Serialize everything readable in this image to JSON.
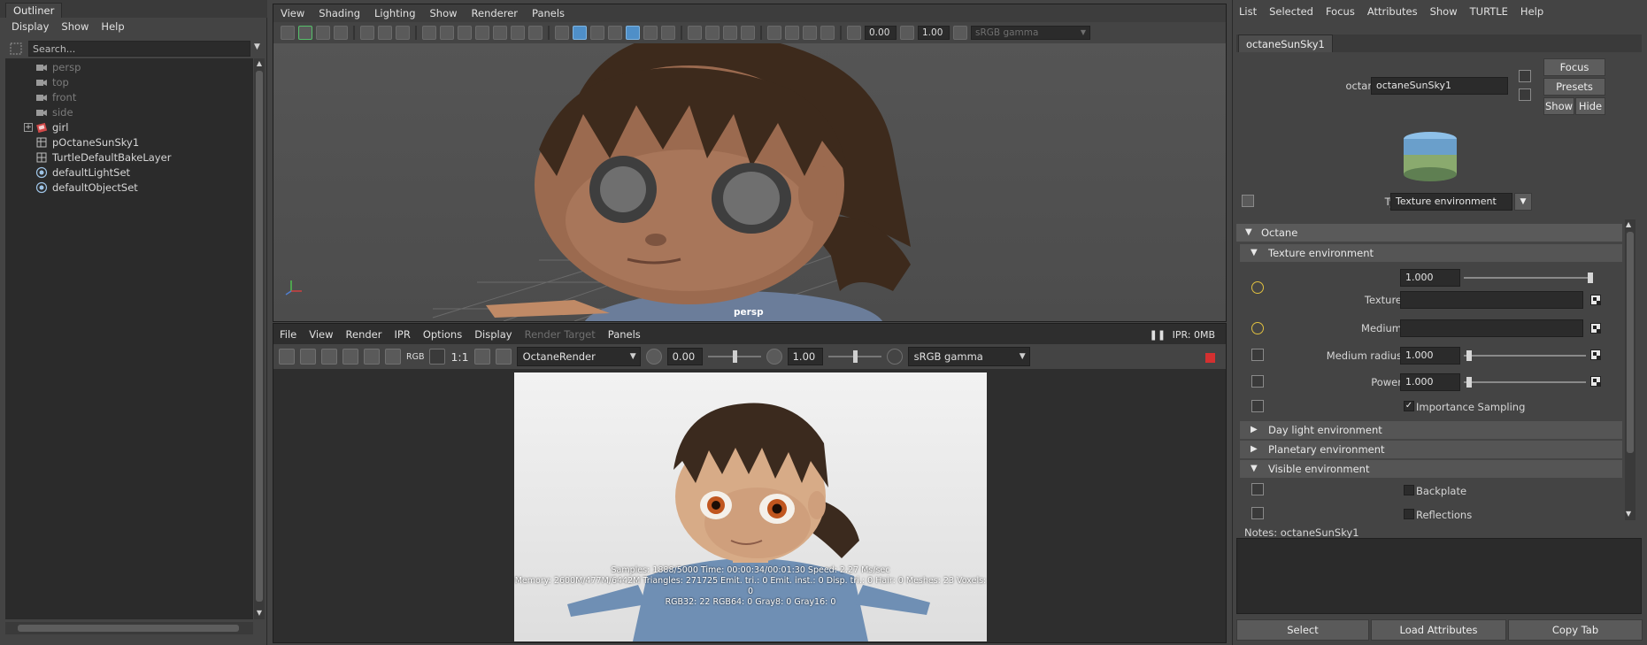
{
  "outliner": {
    "tab": "Outliner",
    "menu": [
      "Display",
      "Show",
      "Help"
    ],
    "search_placeholder": "Search...",
    "items": [
      {
        "label": "persp",
        "icon": "camera-icon"
      },
      {
        "label": "top",
        "icon": "camera-icon"
      },
      {
        "label": "front",
        "icon": "camera-icon"
      },
      {
        "label": "side",
        "icon": "camera-icon"
      },
      {
        "label": "girl",
        "icon": "group-icon"
      },
      {
        "label": "pOctaneSunSky1",
        "icon": "environment-icon"
      },
      {
        "label": "TurtleDefaultBakeLayer",
        "icon": "bake-layer-icon"
      },
      {
        "label": "defaultLightSet",
        "icon": "set-icon"
      },
      {
        "label": "defaultObjectSet",
        "icon": "set-icon"
      }
    ]
  },
  "viewport": {
    "menu": [
      "View",
      "Shading",
      "Lighting",
      "Show",
      "Renderer",
      "Panels"
    ],
    "exposure": "0.00",
    "gamma": "1.00",
    "color_space": "sRGB gamma",
    "camera_label": "persp"
  },
  "renderview": {
    "menu": [
      "File",
      "View",
      "Render",
      "IPR",
      "Options",
      "Display",
      "Render Target",
      "Panels"
    ],
    "rgb_label": "RGB",
    "ratio_label": "1:1",
    "renderer": "OctaneRender",
    "exposure": "0.00",
    "gamma": "1.00",
    "color_space": "sRGB gamma",
    "ipr_status": "IPR: 0MB",
    "stats": [
      "Samples: 1888/5000 Time: 00:00:34/00:01:30 Speed: 2.27 Ms/sec",
      "Memory: 2600M/477M/6442M Triangles: 271725 Emit. tri.: 0 Emit. inst.: 0 Disp. tri.: 0 Hair: 0 Meshes: 23 Voxels: 0",
      "RGB32: 22 RGB64: 0 Gray8: 0 Gray16: 0"
    ]
  },
  "attr": {
    "menu": [
      "List",
      "Selected",
      "Focus",
      "Attributes",
      "Show",
      "TURTLE",
      "Help"
    ],
    "tab": "octaneSunSky1",
    "node_label": "octaneSunSky:",
    "node_value": "octaneSunSky1",
    "focus_btn": "Focus",
    "presets_btn": "Presets",
    "show_btn": "Show",
    "hide_btn": "Hide",
    "type_label": "Type",
    "type_value": "Texture environment",
    "section_octane": "Octane",
    "sub_texture_env": "Texture environment",
    "power_top_value": "1.000",
    "texture_label": "Texture",
    "medium_label": "Medium",
    "medium_radius_label": "Medium radius",
    "medium_radius_value": "1.000",
    "power_label": "Power",
    "power_value": "1.000",
    "importance_label": "Importance Sampling",
    "sub_daylight": "Day light environment",
    "sub_planetary": "Planetary environment",
    "sub_visible": "Visible environment",
    "backplate_label": "Backplate",
    "reflections_label": "Reflections",
    "notes_label": "Notes:  octaneSunSky1",
    "select_btn": "Select",
    "load_btn": "Load Attributes",
    "copy_btn": "Copy Tab"
  }
}
